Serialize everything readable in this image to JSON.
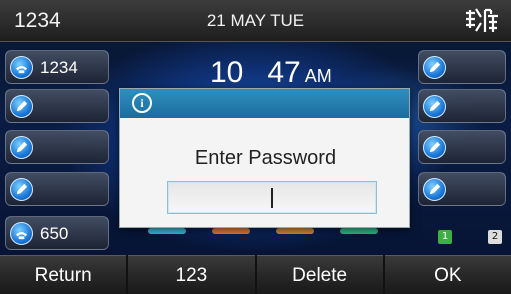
{
  "status_bar": {
    "account": "1234",
    "date": "21 MAY TUE",
    "network_icon": "network-status-icon"
  },
  "clock": {
    "hour": "10",
    "minute": "47",
    "ampm": "AM"
  },
  "line_keys_left": [
    {
      "label": "1234",
      "icon": "phone-line-icon"
    },
    {
      "label": "",
      "icon": "edit-icon"
    },
    {
      "label": "",
      "icon": "edit-icon"
    },
    {
      "label": "",
      "icon": "edit-icon"
    },
    {
      "label": "650",
      "icon": "phone-line-icon"
    }
  ],
  "line_keys_right": [
    {
      "label": "",
      "icon": "edit-icon"
    },
    {
      "label": "",
      "icon": "edit-icon"
    },
    {
      "label": "",
      "icon": "edit-icon"
    },
    {
      "label": "",
      "icon": "edit-icon"
    }
  ],
  "dialog": {
    "icon": "info-icon",
    "icon_glyph": "i",
    "prompt": "Enter Password",
    "input_value": ""
  },
  "page_indicators": {
    "current": "1",
    "other": "2"
  },
  "softkeys": [
    "Return",
    "123",
    "Delete",
    "OK"
  ],
  "colors": {
    "dialog_header": "#1f7aaa",
    "accent_blue": "#1a78d8",
    "page_active": "#3cb043"
  }
}
